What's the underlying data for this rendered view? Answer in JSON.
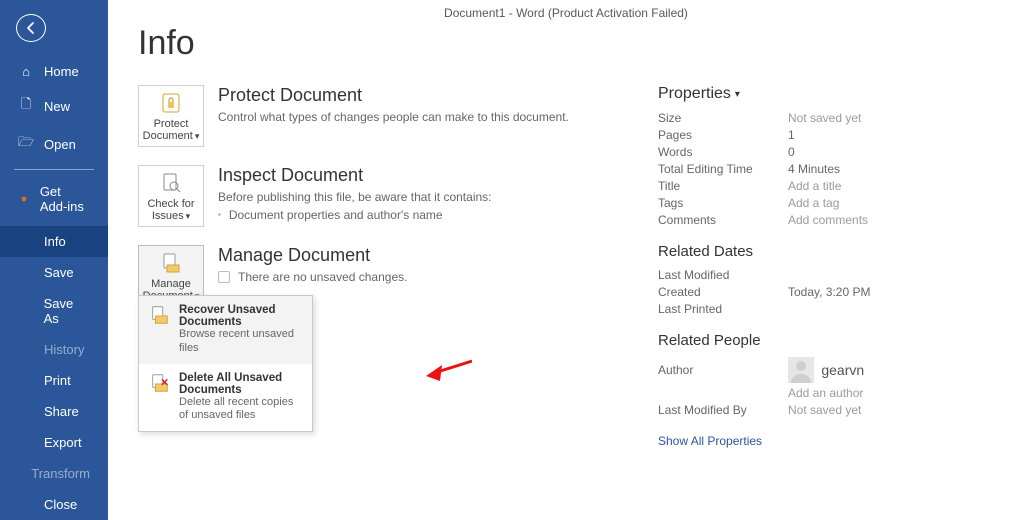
{
  "titlebar": "Document1  -  Word (Product Activation Failed)",
  "page_title": "Info",
  "nav": {
    "home": "Home",
    "new": "New",
    "open": "Open",
    "addins": "Get Add-ins",
    "info": "Info",
    "save": "Save",
    "saveas": "Save As",
    "history": "History",
    "print": "Print",
    "share": "Share",
    "export": "Export",
    "transform": "Transform",
    "close": "Close"
  },
  "protect": {
    "tile_line1": "Protect",
    "tile_line2": "Document",
    "heading": "Protect Document",
    "desc": "Control what types of changes people can make to this document."
  },
  "inspect": {
    "tile_line1": "Check for",
    "tile_line2": "Issues",
    "heading": "Inspect Document",
    "desc": "Before publishing this file, be aware that it contains:",
    "item1": "Document properties and author's name"
  },
  "manage": {
    "tile_line1": "Manage",
    "tile_line2": "Document",
    "heading": "Manage Document",
    "desc": "There are no unsaved changes.",
    "recover_title": "Recover Unsaved Documents",
    "recover_sub": "Browse recent unsaved files",
    "delete_title": "Delete All Unsaved Documents",
    "delete_sub": "Delete all recent copies of unsaved files"
  },
  "props": {
    "header": "Properties",
    "size_l": "Size",
    "size_v": "Not saved yet",
    "pages_l": "Pages",
    "pages_v": "1",
    "words_l": "Words",
    "words_v": "0",
    "time_l": "Total Editing Time",
    "time_v": "4 Minutes",
    "title_l": "Title",
    "title_v": "Add a title",
    "tags_l": "Tags",
    "tags_v": "Add a tag",
    "comments_l": "Comments",
    "comments_v": "Add comments"
  },
  "dates": {
    "header": "Related Dates",
    "lastmod_l": "Last Modified",
    "lastmod_v": "",
    "created_l": "Created",
    "created_v": "Today, 3:20 PM",
    "printed_l": "Last Printed",
    "printed_v": ""
  },
  "people": {
    "header": "Related People",
    "author_l": "Author",
    "author_name": "gearvn",
    "add_author": "Add an author",
    "lastmodby_l": "Last Modified By",
    "lastmodby_v": "Not saved yet"
  },
  "show_all": "Show All Properties"
}
